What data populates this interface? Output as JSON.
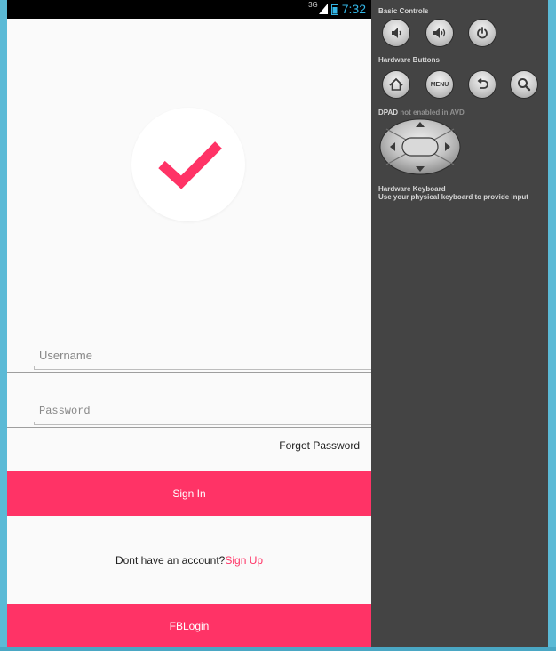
{
  "status_bar": {
    "network_type": "3G",
    "time": "7:32"
  },
  "login": {
    "username_placeholder": "Username",
    "password_placeholder": "Password",
    "forgot_password": "Forgot Password",
    "signin_label": "Sign In",
    "no_account_text": "Dont have an account?",
    "signup_link": "Sign Up",
    "fblogin_label": "FBLogin"
  },
  "colors": {
    "accent": "#ff3366",
    "screen_background": "#fafafa",
    "panel_background": "#444444"
  },
  "emulator_panel": {
    "basic_controls_label": "Basic Controls",
    "basic_controls": [
      "volume-down-icon",
      "volume-up-icon",
      "power-icon"
    ],
    "hardware_buttons_label": "Hardware Buttons",
    "hardware_buttons": [
      "home-icon",
      "menu",
      "back-icon",
      "search-icon"
    ],
    "menu_label": "MENU",
    "dpad_label": "DPAD",
    "dpad_status": "not enabled in AVD",
    "keyboard_label": "Hardware Keyboard",
    "keyboard_hint": "Use your physical keyboard to provide input"
  }
}
